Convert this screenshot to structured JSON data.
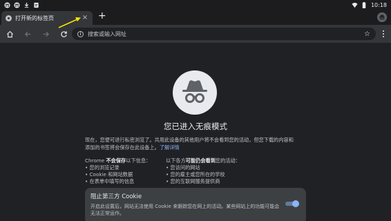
{
  "status_bar": {
    "time": "10:18",
    "left_icons": [
      "incognito-status-icon",
      "incognito-status-icon",
      "download-status-icon",
      "document-status-icon"
    ],
    "right_icons": [
      "wifi-icon",
      "battery-icon"
    ]
  },
  "tab": {
    "title": "打开新的标签页",
    "close_glyph": "×",
    "new_tab_glyph": "+"
  },
  "toolbar": {
    "omnibox_placeholder": "搜索或输入网址",
    "info_glyph": "i",
    "star_glyph": "☆"
  },
  "incognito_page": {
    "heading": "您已进入无痕模式",
    "intro_line1": "现在，您便可进行私密浏览了。共用此设备的其他用户将不会看到您的活动，但您下载的内容和",
    "intro_line2": "添加的书签将会保存在此设备上。",
    "learn_more": "了解详情",
    "left_col": {
      "prefix": "Chrome ",
      "bold": "不会保存",
      "suffix": "以下信息：",
      "items": [
        "您的浏览记录",
        "Cookie 和网站数据",
        "在表单中填写的信息"
      ]
    },
    "right_col": {
      "prefix": "以下各方",
      "bold": "可能仍会看到",
      "suffix": "您的活动：",
      "items": [
        "您访问的网站",
        "您的雇主或您所在的学校",
        "您的互联网服务提供商"
      ]
    },
    "cookie_card": {
      "title": "阻止第三方 Cookie",
      "description": "开启此设置后，网站无法使用 Cookie 来跟踪您在网上的活动。某些网站上的功能可能会无法正常运作。",
      "toggle_on": true
    }
  },
  "colors": {
    "background": "#202124",
    "toolbar": "#35363a",
    "accent": "#8ab4f8",
    "annotation_arrow": "#f2e600"
  }
}
